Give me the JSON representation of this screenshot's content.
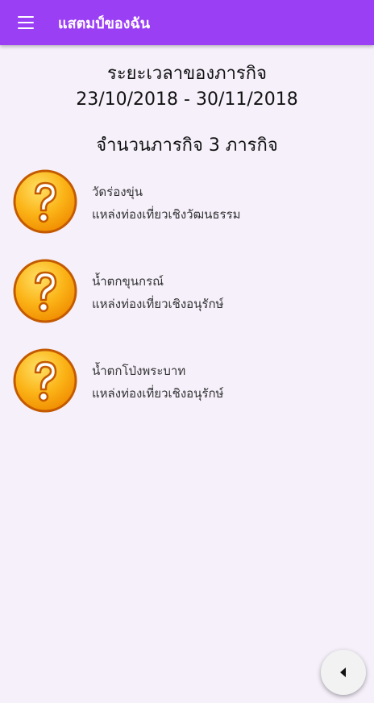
{
  "app_bar": {
    "title": "แสตมป์ของฉัน",
    "menu_icon": "menu-icon",
    "color": "#9b3ff5"
  },
  "header": {
    "period_label": "ระยะเวลาของภารกิจ",
    "period_range": "23/10/2018 - 30/11/2018",
    "mission_count_label": "จำนวนภารกิจ 3 ภารกิจ"
  },
  "missions": [
    {
      "icon": "question-mark-icon",
      "name": "วัดร่องขุ่น",
      "category": "แหล่งท่องเที่ยวเชิงวัฒนธรรม"
    },
    {
      "icon": "question-mark-icon",
      "name": "น้ำตกขุนกรณ์",
      "category": "แหล่งท่องเที่ยวเชิงอนุรักษ์"
    },
    {
      "icon": "question-mark-icon",
      "name": "น้ำตกโป่งพระบาท",
      "category": "แหล่งท่องเที่ยวเชิงอนุรักษ์"
    }
  ],
  "fab": {
    "icon": "back-arrow-icon"
  }
}
